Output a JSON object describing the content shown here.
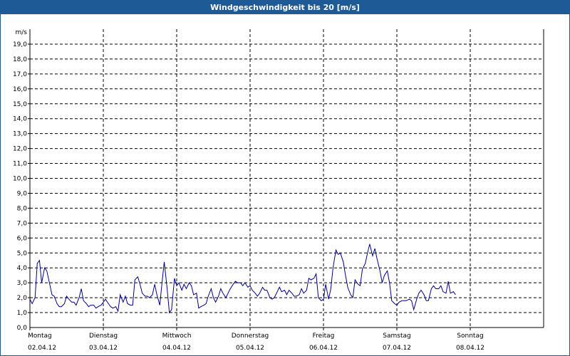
{
  "window": {
    "title": "Windgeschwindigkeit bis 20 [m/s]"
  },
  "chart_data": {
    "type": "line",
    "title": "Windgeschwindigkeit bis 20 [m/s]",
    "unit_label": "m/s",
    "ylim": [
      0,
      20
    ],
    "yticks": [
      "1,0",
      "2,0",
      "3,0",
      "4,0",
      "5,0",
      "6,0",
      "7,0",
      "8,0",
      "9,0",
      "10,0",
      "11,0",
      "12,0",
      "13,0",
      "14,0",
      "15,0",
      "16,0",
      "17,0",
      "18,0",
      "19,0"
    ],
    "y_zero_label": "0,0",
    "xlim": [
      0,
      7
    ],
    "days": [
      {
        "weekday": "Montag",
        "date": "02.04.12"
      },
      {
        "weekday": "Dienstag",
        "date": "03.04.12"
      },
      {
        "weekday": "Mittwoch",
        "date": "04.04.12"
      },
      {
        "weekday": "Donnerstag",
        "date": "05.04.12"
      },
      {
        "weekday": "Freitag",
        "date": "06.04.12"
      },
      {
        "weekday": "Samstag",
        "date": "07.04.12"
      },
      {
        "weekday": "Sonntag",
        "date": "08.04.12"
      }
    ],
    "grid": true,
    "line_color": "#00008b",
    "series": [
      {
        "values": [
          [
            0.0,
            1.9
          ],
          [
            0.03,
            1.6
          ],
          [
            0.07,
            2.0
          ],
          [
            0.1,
            4.3
          ],
          [
            0.13,
            4.5
          ],
          [
            0.16,
            3.0
          ],
          [
            0.2,
            4.0
          ],
          [
            0.23,
            3.8
          ],
          [
            0.27,
            2.9
          ],
          [
            0.3,
            2.2
          ],
          [
            0.33,
            2.1
          ],
          [
            0.37,
            1.6
          ],
          [
            0.4,
            1.4
          ],
          [
            0.43,
            1.4
          ],
          [
            0.47,
            1.6
          ],
          [
            0.5,
            2.1
          ],
          [
            0.53,
            1.9
          ],
          [
            0.57,
            1.7
          ],
          [
            0.6,
            1.7
          ],
          [
            0.63,
            1.5
          ],
          [
            0.67,
            2.0
          ],
          [
            0.7,
            2.6
          ],
          [
            0.73,
            1.8
          ],
          [
            0.77,
            1.6
          ],
          [
            0.8,
            1.4
          ],
          [
            0.83,
            1.5
          ],
          [
            0.87,
            1.5
          ],
          [
            0.9,
            1.3
          ],
          [
            0.93,
            1.4
          ],
          [
            0.97,
            1.5
          ],
          [
            1.0,
            1.7
          ],
          [
            1.03,
            1.9
          ],
          [
            1.07,
            1.6
          ],
          [
            1.1,
            1.4
          ],
          [
            1.13,
            1.3
          ],
          [
            1.17,
            1.4
          ],
          [
            1.2,
            1.1
          ],
          [
            1.23,
            2.2
          ],
          [
            1.27,
            1.7
          ],
          [
            1.3,
            2.1
          ],
          [
            1.33,
            1.6
          ],
          [
            1.37,
            1.5
          ],
          [
            1.4,
            1.5
          ],
          [
            1.43,
            3.2
          ],
          [
            1.47,
            3.4
          ],
          [
            1.5,
            2.9
          ],
          [
            1.53,
            2.3
          ],
          [
            1.57,
            2.1
          ],
          [
            1.6,
            2.1
          ],
          [
            1.63,
            2.0
          ],
          [
            1.67,
            2.2
          ],
          [
            1.7,
            2.9
          ],
          [
            1.73,
            2.2
          ],
          [
            1.77,
            1.5
          ],
          [
            1.8,
            3.0
          ],
          [
            1.83,
            4.4
          ],
          [
            1.87,
            2.6
          ],
          [
            1.9,
            1.0
          ],
          [
            1.93,
            1.2
          ],
          [
            1.97,
            3.3
          ],
          [
            2.0,
            2.8
          ],
          [
            2.03,
            3.0
          ],
          [
            2.07,
            2.5
          ],
          [
            2.1,
            2.9
          ],
          [
            2.13,
            2.6
          ],
          [
            2.17,
            3.0
          ],
          [
            2.2,
            2.8
          ],
          [
            2.23,
            2.2
          ],
          [
            2.27,
            2.3
          ],
          [
            2.3,
            1.3
          ],
          [
            2.33,
            1.4
          ],
          [
            2.37,
            1.5
          ],
          [
            2.4,
            1.6
          ],
          [
            2.43,
            2.1
          ],
          [
            2.47,
            2.6
          ],
          [
            2.5,
            2.0
          ],
          [
            2.53,
            1.7
          ],
          [
            2.57,
            2.1
          ],
          [
            2.6,
            2.6
          ],
          [
            2.63,
            2.3
          ],
          [
            2.67,
            2.0
          ],
          [
            2.7,
            2.3
          ],
          [
            2.73,
            2.6
          ],
          [
            2.77,
            2.9
          ],
          [
            2.8,
            3.1
          ],
          [
            2.83,
            3.0
          ],
          [
            2.87,
            3.0
          ],
          [
            2.9,
            2.8
          ],
          [
            2.93,
            3.0
          ],
          [
            2.97,
            2.7
          ],
          [
            3.0,
            2.8
          ],
          [
            3.03,
            2.5
          ],
          [
            3.07,
            2.3
          ],
          [
            3.1,
            2.1
          ],
          [
            3.13,
            2.3
          ],
          [
            3.17,
            2.7
          ],
          [
            3.2,
            2.5
          ],
          [
            3.23,
            2.5
          ],
          [
            3.27,
            2.0
          ],
          [
            3.3,
            1.9
          ],
          [
            3.33,
            2.0
          ],
          [
            3.37,
            2.4
          ],
          [
            3.4,
            2.7
          ],
          [
            3.43,
            2.4
          ],
          [
            3.47,
            2.5
          ],
          [
            3.5,
            2.2
          ],
          [
            3.53,
            2.5
          ],
          [
            3.57,
            2.3
          ],
          [
            3.6,
            2.1
          ],
          [
            3.63,
            2.1
          ],
          [
            3.67,
            2.2
          ],
          [
            3.7,
            2.6
          ],
          [
            3.73,
            2.3
          ],
          [
            3.77,
            2.5
          ],
          [
            3.8,
            3.3
          ],
          [
            3.83,
            3.2
          ],
          [
            3.87,
            3.3
          ],
          [
            3.9,
            3.6
          ],
          [
            3.93,
            2.0
          ],
          [
            3.97,
            1.8
          ],
          [
            4.0,
            1.9
          ],
          [
            4.03,
            2.9
          ],
          [
            4.07,
            1.9
          ],
          [
            4.1,
            2.6
          ],
          [
            4.13,
            4.0
          ],
          [
            4.17,
            5.2
          ],
          [
            4.2,
            4.9
          ],
          [
            4.23,
            5.0
          ],
          [
            4.27,
            4.4
          ],
          [
            4.3,
            3.5
          ],
          [
            4.33,
            2.7
          ],
          [
            4.37,
            2.2
          ],
          [
            4.4,
            2.0
          ],
          [
            4.43,
            3.2
          ],
          [
            4.47,
            2.9
          ],
          [
            4.5,
            2.8
          ],
          [
            4.53,
            3.9
          ],
          [
            4.57,
            4.3
          ],
          [
            4.6,
            5.0
          ],
          [
            4.63,
            5.6
          ],
          [
            4.67,
            4.8
          ],
          [
            4.7,
            5.3
          ],
          [
            4.73,
            4.6
          ],
          [
            4.77,
            3.8
          ],
          [
            4.8,
            3.0
          ],
          [
            4.83,
            3.5
          ],
          [
            4.87,
            3.8
          ],
          [
            4.9,
            3.0
          ],
          [
            4.93,
            1.8
          ],
          [
            4.97,
            1.6
          ],
          [
            5.0,
            1.5
          ],
          [
            5.03,
            1.7
          ],
          [
            5.07,
            1.8
          ],
          [
            5.1,
            1.8
          ],
          [
            5.13,
            1.8
          ],
          [
            5.17,
            1.9
          ],
          [
            5.2,
            1.8
          ],
          [
            5.23,
            1.2
          ],
          [
            5.27,
            1.9
          ],
          [
            5.3,
            2.3
          ],
          [
            5.33,
            2.5
          ],
          [
            5.37,
            2.2
          ],
          [
            5.4,
            1.8
          ],
          [
            5.43,
            1.8
          ],
          [
            5.47,
            2.6
          ],
          [
            5.5,
            2.8
          ],
          [
            5.53,
            2.6
          ],
          [
            5.57,
            2.6
          ],
          [
            5.6,
            2.8
          ],
          [
            5.63,
            2.4
          ],
          [
            5.67,
            2.3
          ],
          [
            5.7,
            3.1
          ],
          [
            5.73,
            2.3
          ],
          [
            5.77,
            2.4
          ],
          [
            5.8,
            2.2
          ]
        ]
      }
    ]
  }
}
